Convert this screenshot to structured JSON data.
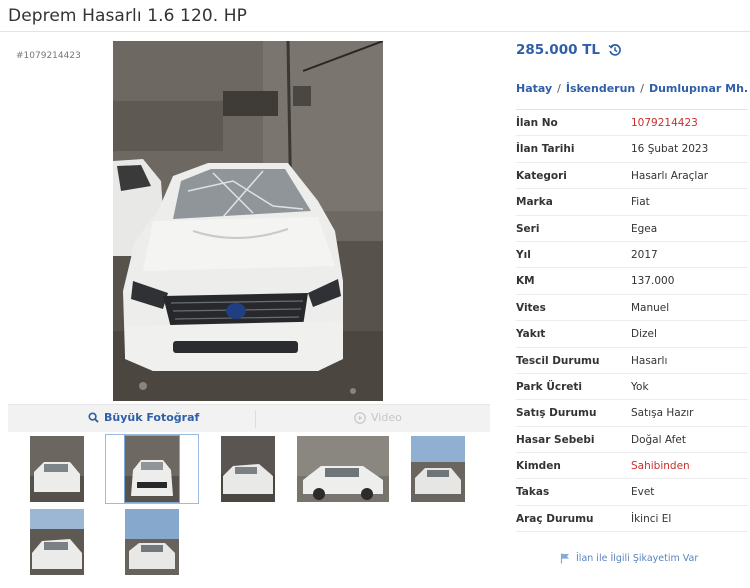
{
  "listing": {
    "title": "Deprem Hasarlı 1.6 120. HP",
    "id_label": "#1079214423",
    "price": "285.000 TL",
    "location": {
      "city": "Hatay",
      "district": "İskenderun",
      "neighborhood": "Dumlupınar Mh.",
      "separator": "/"
    },
    "details": [
      {
        "label": "İlan No",
        "value": "1079214423",
        "highlight": true
      },
      {
        "label": "İlan Tarihi",
        "value": "16 Şubat 2023",
        "highlight": false
      },
      {
        "label": "Kategori",
        "value": "Hasarlı Araçlar",
        "highlight": false
      },
      {
        "label": "Marka",
        "value": "Fiat",
        "highlight": false
      },
      {
        "label": "Seri",
        "value": "Egea",
        "highlight": false
      },
      {
        "label": "Yıl",
        "value": "2017",
        "highlight": false
      },
      {
        "label": "KM",
        "value": "137.000",
        "highlight": false
      },
      {
        "label": "Vites",
        "value": "Manuel",
        "highlight": false
      },
      {
        "label": "Yakıt",
        "value": "Dizel",
        "highlight": false
      },
      {
        "label": "Tescil Durumu",
        "value": "Hasarlı",
        "highlight": false
      },
      {
        "label": "Park Ücreti",
        "value": "Yok",
        "highlight": false
      },
      {
        "label": "Satış Durumu",
        "value": "Satışa Hazır",
        "highlight": false
      },
      {
        "label": "Hasar Sebebi",
        "value": "Doğal Afet",
        "highlight": false
      },
      {
        "label": "Kimden",
        "value": "Sahibinden",
        "highlight": true
      },
      {
        "label": "Takas",
        "value": "Evet",
        "highlight": false
      },
      {
        "label": "Araç Durumu",
        "value": "İkinci El",
        "highlight": false
      }
    ],
    "complaint_link": "İlan ile İlgili Şikayetim Var"
  },
  "gallery": {
    "big_photo_label": "Büyük Fotoğraf",
    "video_label": "Video",
    "thumbnail_count": 7,
    "selected_thumbnail": 2
  },
  "colors": {
    "link_blue": "#2f5fa8",
    "highlight_red": "#c9302c",
    "tab_background": "#f2f2f2"
  },
  "icons": {
    "price": "price-history-icon",
    "big_photo": "magnifier-icon",
    "video": "play-icon",
    "complaint": "flag-icon"
  }
}
